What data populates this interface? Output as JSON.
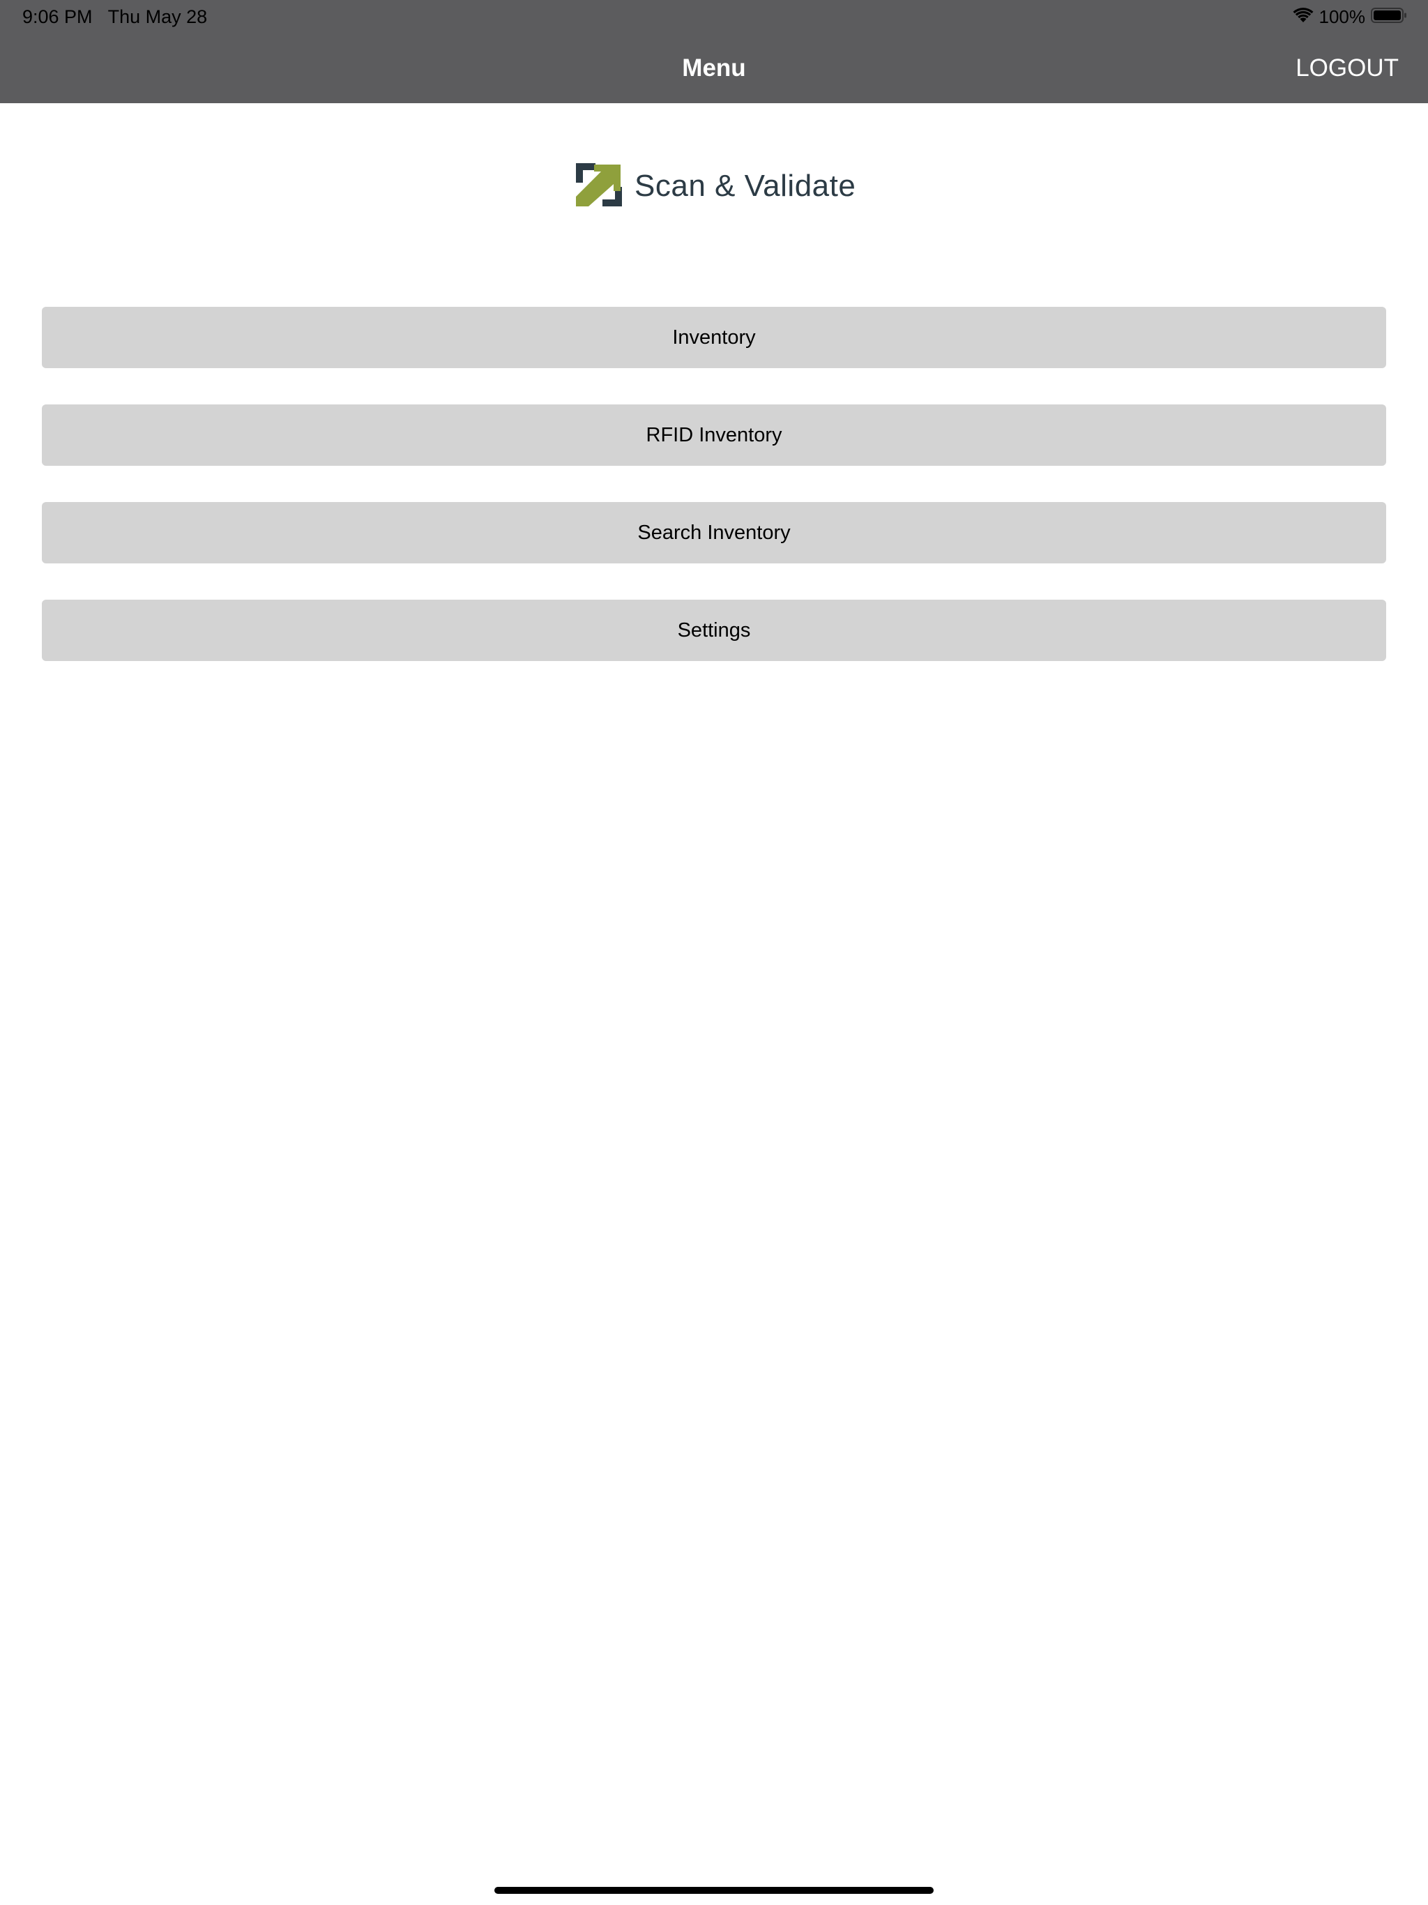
{
  "status_bar": {
    "time": "9:06 PM",
    "date": "Thu May 28",
    "battery_percent": "100%",
    "icons": [
      "wifi-icon",
      "battery-icon"
    ]
  },
  "nav": {
    "title": "Menu",
    "logout_label": "LOGOUT"
  },
  "logo": {
    "text": "Scan & Validate",
    "icon": "scan-validate-logo-icon",
    "colors": {
      "dark": "#2c3b45",
      "accent": "#8fa03c"
    }
  },
  "menu": {
    "items": [
      {
        "label": "Inventory"
      },
      {
        "label": "RFID Inventory"
      },
      {
        "label": "Search Inventory"
      },
      {
        "label": "Settings"
      }
    ]
  },
  "colors": {
    "top_bar": "#5c5c5e",
    "button_bg": "#d3d3d3",
    "background": "#ffffff"
  }
}
